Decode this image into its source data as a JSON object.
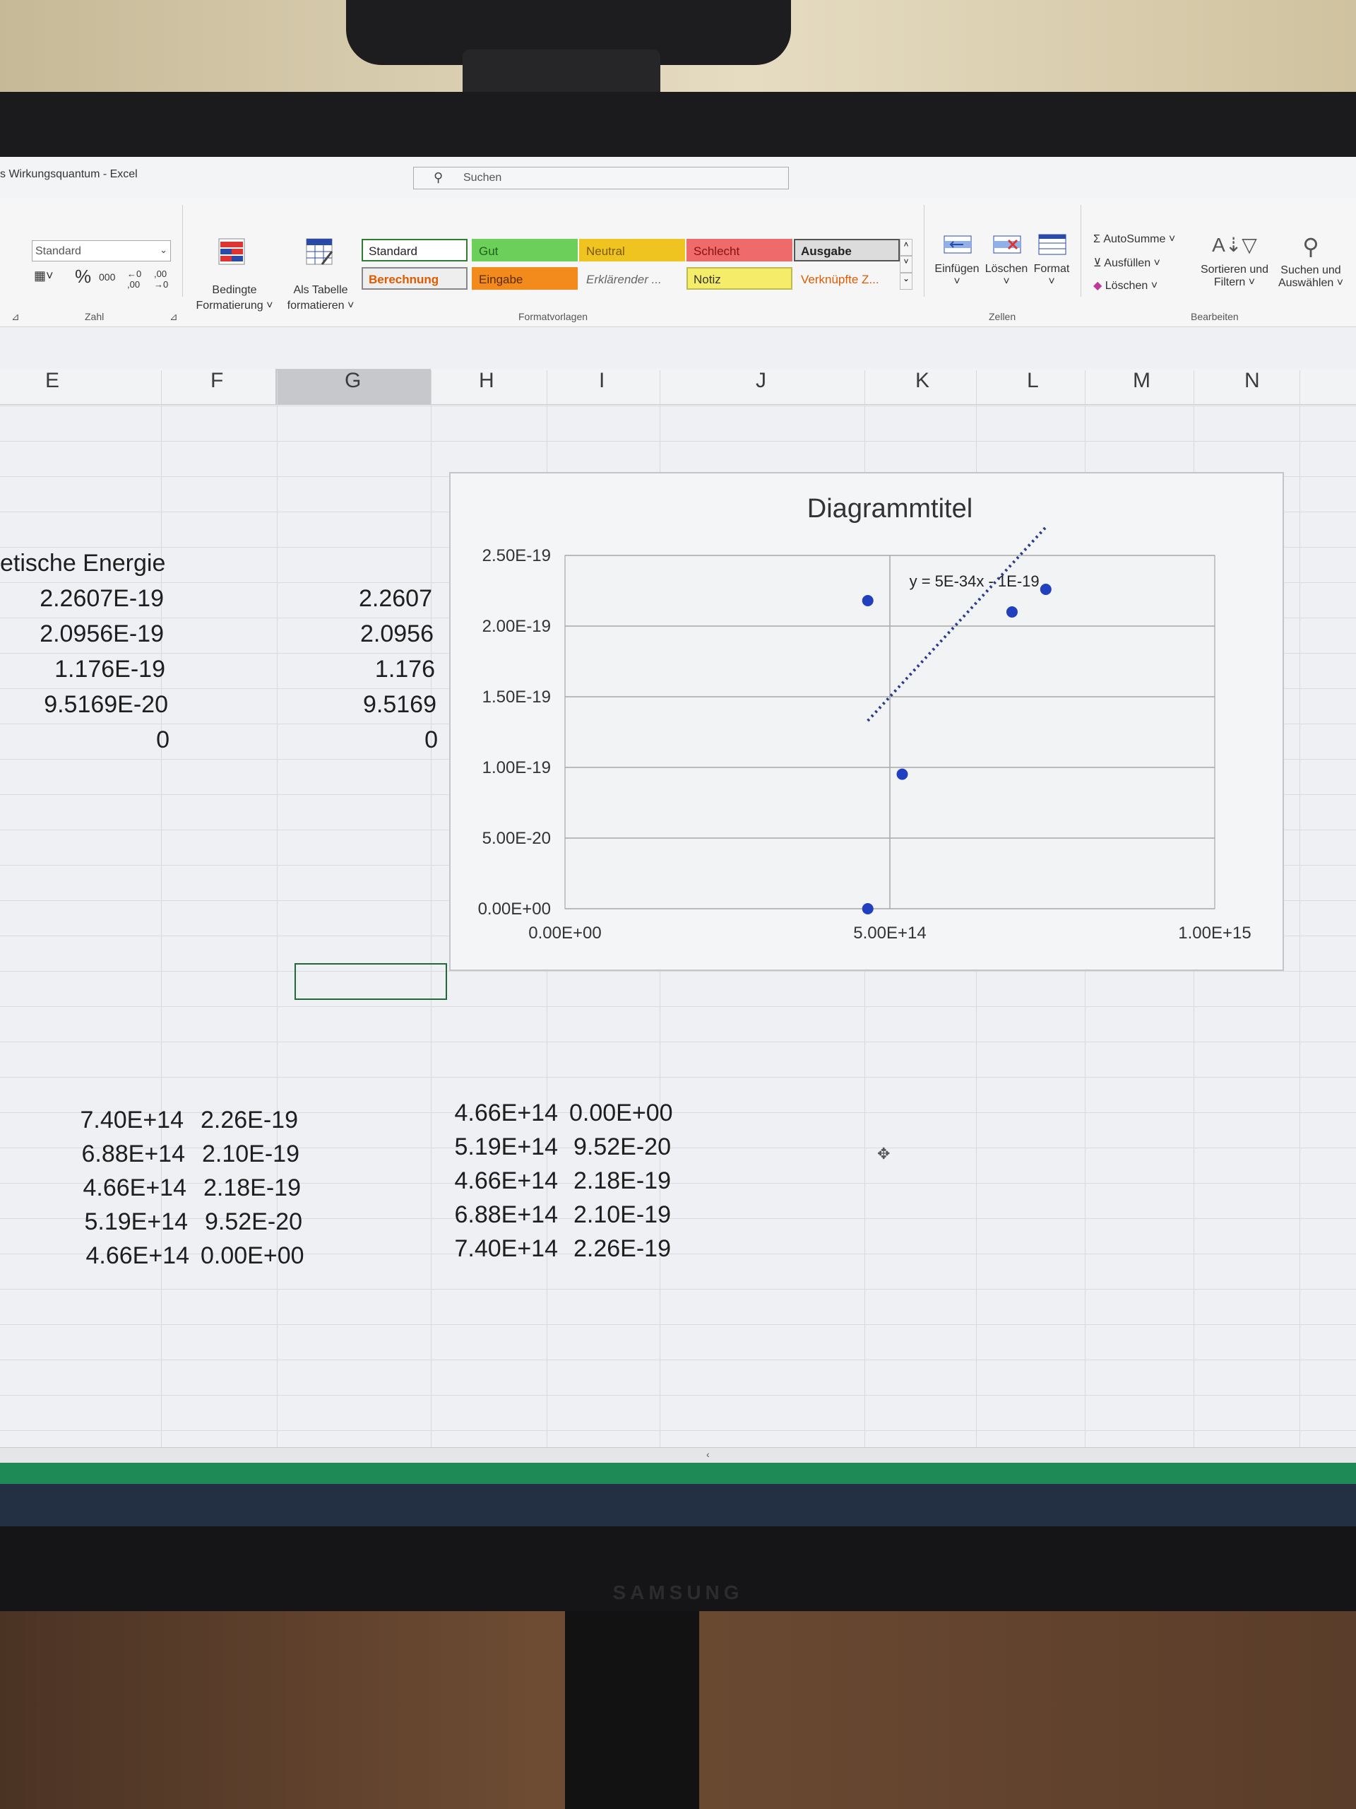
{
  "window": {
    "title": "s Wirkungsquantum  -  Excel",
    "search_placeholder": "Suchen"
  },
  "ribbon": {
    "number_format": "Standard",
    "number_buttons": [
      "% ",
      "000",
      "←0 ,00",
      ",00 →0"
    ],
    "group_zahl": "Zahl",
    "conditional_formatting": [
      "Bedingte",
      "Formatierung ˅"
    ],
    "format_as_table": [
      "Als Tabelle",
      "formatieren ˅"
    ],
    "group_formatvorlagen": "Formatvorlagen",
    "styles": [
      {
        "label": "Standard",
        "bg": "#ffffff",
        "fg": "#222222",
        "border": "#2e7d32"
      },
      {
        "label": "Gut",
        "bg": "#6ccf5a",
        "fg": "#1f5f1f",
        "border": "#6ccf5a"
      },
      {
        "label": "Neutral",
        "bg": "#f0c420",
        "fg": "#7a5a00",
        "border": "#f0c420"
      },
      {
        "label": "Schlecht",
        "bg": "#ef6a6a",
        "fg": "#8a1010",
        "border": "#ef6a6a"
      },
      {
        "label": "Ausgabe",
        "bg": "#dcdcdc",
        "fg": "#222222",
        "border": "#555555"
      },
      {
        "label": "Berechnung",
        "bg": "#eeeeee",
        "fg": "#e05a00",
        "border": "#888888"
      },
      {
        "label": "Eingabe",
        "bg": "#f28a1c",
        "fg": "#5a2a00",
        "border": "#f28a1c"
      },
      {
        "label": "Erklärender ...",
        "bg": "#f6f6f7",
        "fg": "#666666",
        "border": "#f6f6f7"
      },
      {
        "label": "Notiz",
        "bg": "#f5ec6a",
        "fg": "#333333",
        "border": "#bbbb55"
      },
      {
        "label": "Verknüpfte Z...",
        "bg": "#f6f6f7",
        "fg": "#e05a00",
        "border": "#f6f6f7"
      }
    ],
    "cells_buttons": [
      "Einfügen",
      "Löschen",
      "Format"
    ],
    "group_zellen": "Zellen",
    "editing": {
      "autosumme": "Σ AutoSumme ˅",
      "ausfuellen": "Ausfüllen ˅",
      "loeschen": "Löschen ˅",
      "sort": [
        "Sortieren und",
        "Filtern ˅"
      ],
      "find": [
        "Suchen und",
        "Auswählen ˅"
      ]
    },
    "group_bearbeiten": "Bearbeiten"
  },
  "sheet": {
    "columns": [
      "E",
      "F",
      "G",
      "H",
      "I",
      "J",
      "K",
      "L",
      "M",
      "N"
    ],
    "e_header": "etische Energie",
    "e_values": [
      "2.2607E-19",
      "2.0956E-19",
      "1.176E-19",
      "9.5169E-20",
      "0"
    ],
    "g_values": [
      "2.2607",
      "2.0956",
      "1.176",
      "9.5169",
      "0"
    ],
    "table_left": [
      [
        "7.40E+14",
        "2.26E-19"
      ],
      [
        "6.88E+14",
        "2.10E-19"
      ],
      [
        "4.66E+14",
        "2.18E-19"
      ],
      [
        "5.19E+14",
        "9.52E-20"
      ],
      [
        "4.66E+14",
        "0.00E+00"
      ]
    ],
    "table_right": [
      [
        "4.66E+14",
        "0.00E+00"
      ],
      [
        "5.19E+14",
        "9.52E-20"
      ],
      [
        "4.66E+14",
        "2.18E-19"
      ],
      [
        "6.88E+14",
        "2.10E-19"
      ],
      [
        "7.40E+14",
        "2.26E-19"
      ]
    ]
  },
  "chart_data": {
    "type": "scatter",
    "title": "Diagrammtitel",
    "x_tick_labels": [
      "0.00E+00",
      "5.00E+14",
      "1.00E+15"
    ],
    "y_tick_labels": [
      "0.00E+00",
      "5.00E-20",
      "1.00E-19",
      "1.50E-19",
      "2.00E-19",
      "2.50E-19"
    ],
    "xlim": [
      0,
      1000000000000000.0
    ],
    "ylim": [
      0,
      2.5e-19
    ],
    "points": [
      {
        "x": 466000000000000.0,
        "y": 0
      },
      {
        "x": 519000000000000.0,
        "y": 9.52e-20
      },
      {
        "x": 466000000000000.0,
        "y": 2.18e-19
      },
      {
        "x": 688000000000000.0,
        "y": 2.1e-19
      },
      {
        "x": 740000000000000.0,
        "y": 2.26e-19
      }
    ],
    "trendline": {
      "label": "y = 5E-34x - 1E-19",
      "x_range": [
        466000000000000.0,
        740000000000000.0
      ],
      "style": "dotted",
      "color": "#2a3a8c"
    },
    "marker_color": "#2040c0",
    "grid": true
  },
  "brand": "SAMSUNG"
}
